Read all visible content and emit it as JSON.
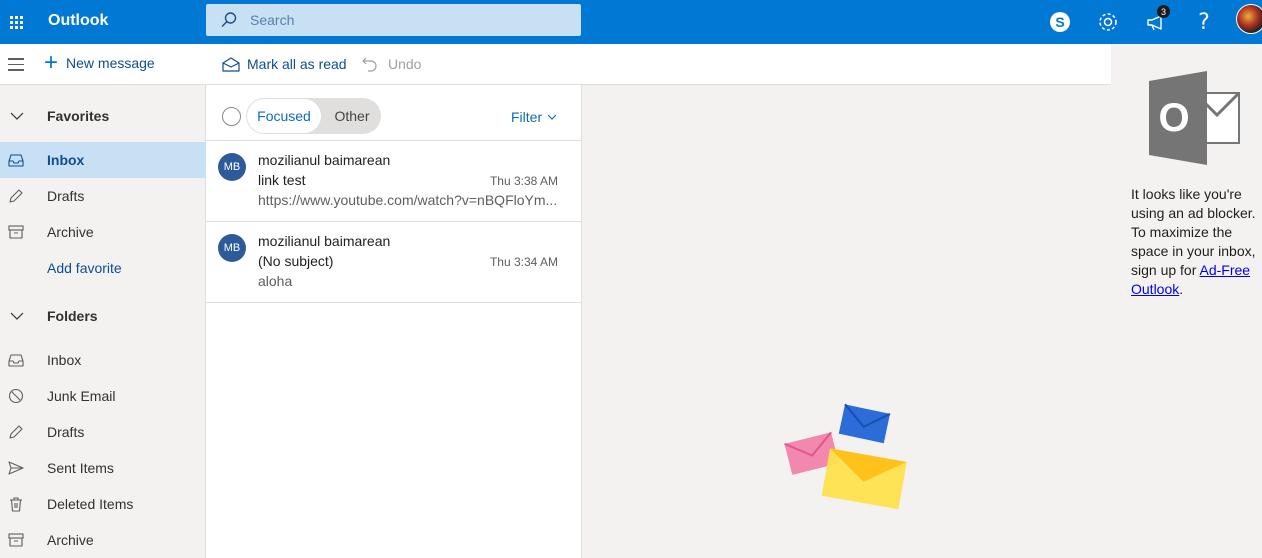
{
  "app": {
    "title": "Outlook"
  },
  "search": {
    "placeholder": "Search"
  },
  "header": {
    "notification_count": "3"
  },
  "command_bar": {
    "new_message": "New message",
    "mark_all_read": "Mark all as read",
    "undo": "Undo"
  },
  "nav": {
    "favorites": {
      "title": "Favorites",
      "items": [
        {
          "label": "Inbox",
          "icon": "inbox-icon",
          "selected": true
        },
        {
          "label": "Drafts",
          "icon": "pencil-icon"
        },
        {
          "label": "Archive",
          "icon": "archive-icon"
        }
      ],
      "add_favorite": "Add favorite"
    },
    "folders": {
      "title": "Folders",
      "items": [
        {
          "label": "Inbox",
          "icon": "inbox-icon"
        },
        {
          "label": "Junk Email",
          "icon": "block-icon"
        },
        {
          "label": "Drafts",
          "icon": "pencil-icon"
        },
        {
          "label": "Sent Items",
          "icon": "send-icon"
        },
        {
          "label": "Deleted Items",
          "icon": "trash-icon"
        },
        {
          "label": "Archive",
          "icon": "archive-icon"
        }
      ]
    }
  },
  "list": {
    "tabs": {
      "focused": "Focused",
      "other": "Other"
    },
    "filter": "Filter",
    "messages": [
      {
        "initials": "MB",
        "from": "mozilianul baimarean",
        "subject": "link test",
        "time": "Thu 3:38 AM",
        "preview": "https://www.youtube.com/watch?v=nBQFloYm..."
      },
      {
        "initials": "MB",
        "from": "mozilianul baimarean",
        "subject": "(No subject)",
        "time": "Thu 3:34 AM",
        "preview": "aloha"
      }
    ]
  },
  "ad_pane": {
    "text": "It looks like you're using an ad blocker. To maximize the space in your inbox, sign up for ",
    "link": "Ad-Free Outlook",
    "suffix": "."
  },
  "colors": {
    "brand": "#0078d4",
    "nav_selected": "#c7e0f4",
    "avatar": "#2d5b9a",
    "link": "#0f6cbd"
  }
}
